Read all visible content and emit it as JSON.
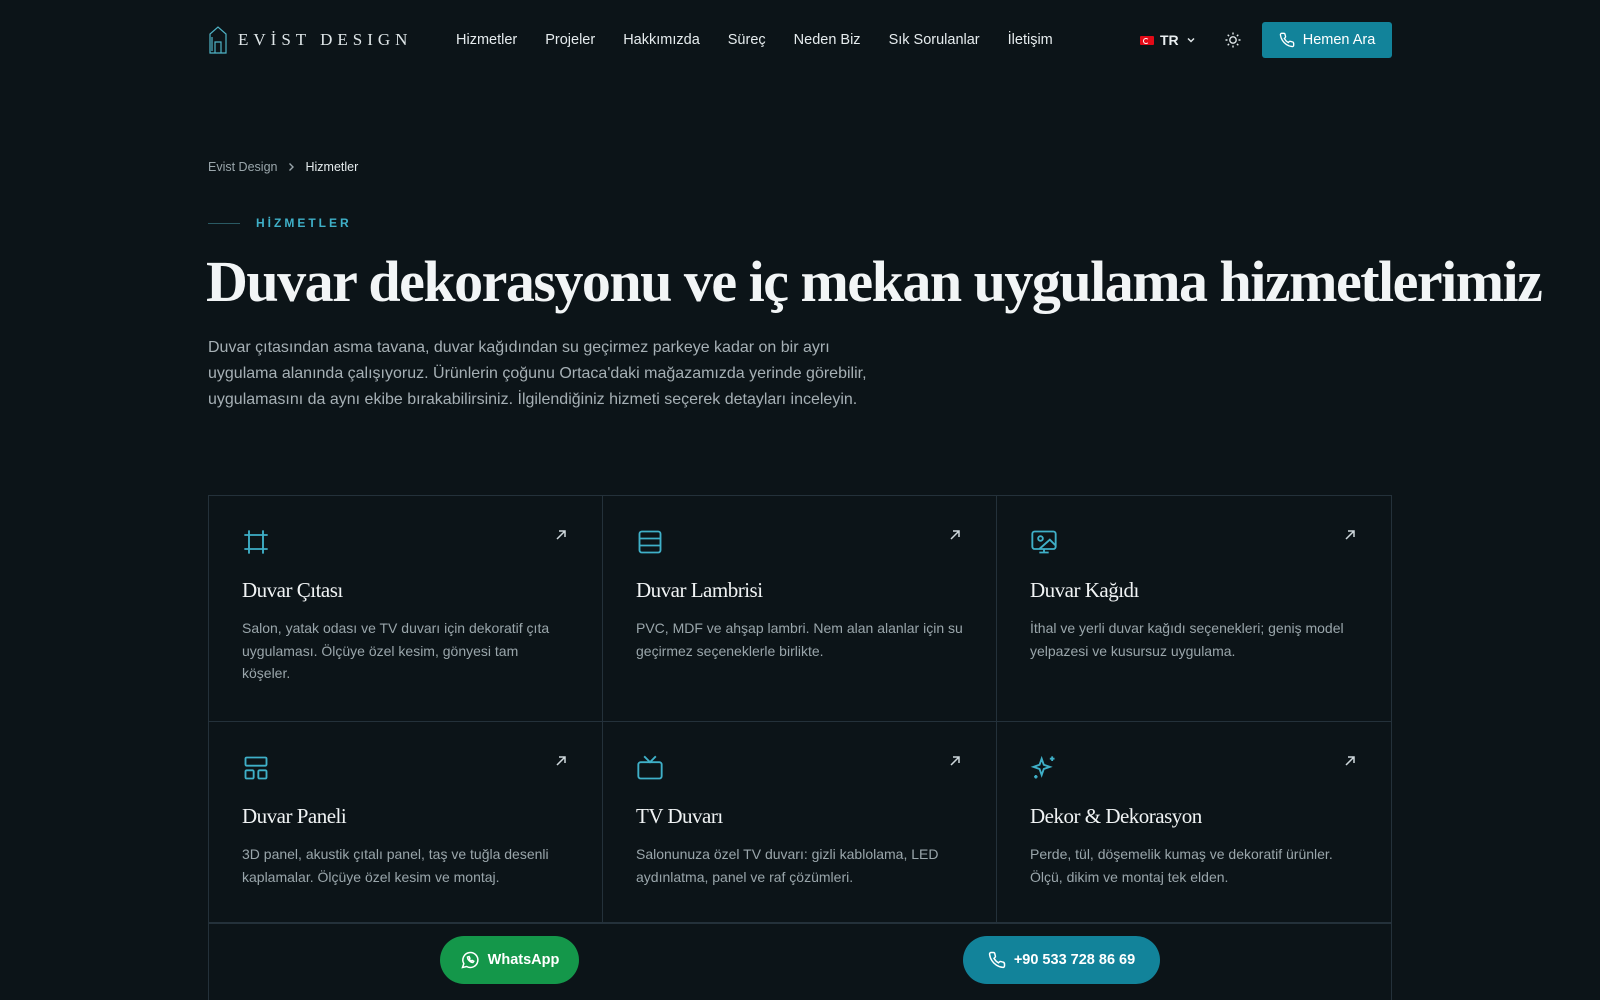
{
  "header": {
    "logo_text": "EVİST DESIGN",
    "nav": [
      "Hizmetler",
      "Projeler",
      "Hakkımızda",
      "Süreç",
      "Neden Biz",
      "Sık Sorulanlar",
      "İletişim"
    ],
    "lang": "TR",
    "cta_label": "Hemen Ara"
  },
  "breadcrumb": {
    "home": "Evist Design",
    "current": "Hizmetler"
  },
  "eyebrow": "HİZMETLER",
  "title": "Duvar dekorasyonu ve iç mekan uygulama hizmetlerimiz",
  "lead": "Duvar çıtasından asma tavana, duvar kağıdından su geçirmez parkeye kadar on bir ayrı uygulama alanında çalışıyoruz. Ürünlerin çoğunu Ortaca'daki mağazamızda yerinde görebilir, uygulamasını da aynı ekibe bırakabilirsiniz. İlgilendiğiniz hizmeti seçerek detayları inceleyin.",
  "services": [
    {
      "title": "Duvar Çıtası",
      "icon": "frame-icon",
      "desc": "Salon, yatak odası ve TV duvarı için dekoratif çıta uygulaması. Ölçüye özel kesim, gönyesi tam köşeler."
    },
    {
      "title": "Duvar Lambrisi",
      "icon": "rows-icon",
      "desc": "PVC, MDF ve ahşap lambri. Nem alan alanlar için su geçirmez seçeneklerle birlikte."
    },
    {
      "title": "Duvar Kağıdı",
      "icon": "image-icon",
      "desc": "İthal ve yerli duvar kağıdı seçenekleri; geniş model yelpazesi ve kusursuz uygulama."
    },
    {
      "title": "Duvar Paneli",
      "icon": "layout-icon",
      "desc": "3D panel, akustik çıtalı panel, taş ve tuğla desenli kaplamalar. Ölçüye özel kesim ve montaj."
    },
    {
      "title": "TV Duvarı",
      "icon": "tv-icon",
      "desc": "Salonunuza özel TV duvarı: gizli kablolama, LED aydınlatma, panel ve raf çözümleri."
    },
    {
      "title": "Dekor & Dekorasyon",
      "icon": "sparkles-icon",
      "desc": "Perde, tül, döşemelik kumaş ve dekoratif ürünler. Ölçü, dikim ve montaj tek elden."
    }
  ],
  "floating": {
    "whatsapp": "WhatsApp",
    "phone": "+90 533 728 86 69"
  },
  "colors": {
    "accent": "#12839a",
    "icon": "#3fb0c8",
    "whatsapp": "#14974a",
    "background": "#0c1418"
  }
}
